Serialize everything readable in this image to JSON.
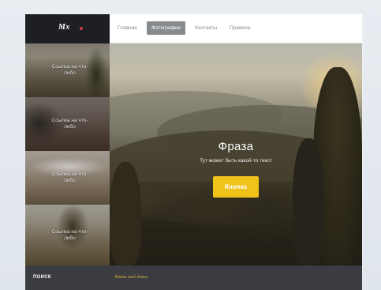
{
  "logo": {
    "text": "Mx"
  },
  "sidebar": {
    "items": [
      {
        "caption": "Ссылка на что-либо"
      },
      {
        "caption": "Ссылка на что-либо"
      },
      {
        "caption": "Ссылка на что-либо"
      },
      {
        "caption": "Ссылка на что-либо"
      }
    ]
  },
  "nav": {
    "items": [
      {
        "label": "Главная"
      },
      {
        "label": "Фотографии"
      },
      {
        "label": "Контакты"
      },
      {
        "label": "Правила"
      }
    ],
    "active_index": 1
  },
  "hero": {
    "title": "Фраза",
    "subtitle": "Тут может быть какой-то текст",
    "button_label": "Кнопка"
  },
  "footer": {
    "label": "ПОИСК",
    "tagline": "Жить мой девиз"
  },
  "colors": {
    "accent": "#f0c31a",
    "logo_dot": "#c6454a",
    "footer_bg": "#3a3c41",
    "tagline": "#d6b437",
    "nav_active_bg": "#888b8e"
  }
}
